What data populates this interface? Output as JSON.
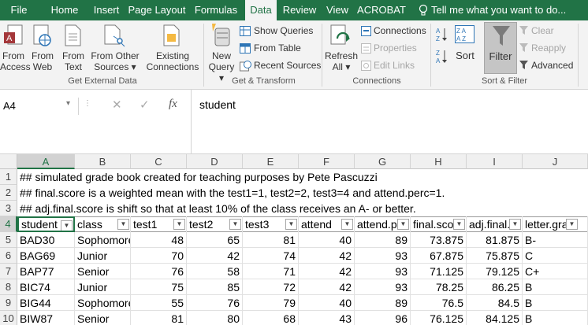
{
  "tabs": [
    "File",
    "Home",
    "Insert",
    "Page Layout",
    "Formulas",
    "Data",
    "Review",
    "View",
    "ACROBAT"
  ],
  "tell_me": "Tell me what you want to do...",
  "ribbon": {
    "from_access": [
      "From",
      "Access"
    ],
    "from_web": [
      "From",
      "Web"
    ],
    "from_text": [
      "From",
      "Text"
    ],
    "from_other": [
      "From Other",
      "Sources"
    ],
    "existing": [
      "Existing",
      "Connections"
    ],
    "group_external": "Get External Data",
    "new_query": [
      "New",
      "Query"
    ],
    "show_queries": "Show Queries",
    "from_table": "From Table",
    "recent_sources": "Recent Sources",
    "group_transform": "Get & Transform",
    "refresh_all": [
      "Refresh",
      "All"
    ],
    "connections": "Connections",
    "properties": "Properties",
    "edit_links": "Edit Links",
    "group_connections": "Connections",
    "sort": "Sort",
    "filter": "Filter",
    "clear": "Clear",
    "reapply": "Reapply",
    "advanced": "Advanced",
    "group_sort": "Sort & Filter"
  },
  "formula_bar": {
    "name_box": "A4",
    "fx": "fx",
    "content": "student"
  },
  "columns": [
    "A",
    "B",
    "C",
    "D",
    "E",
    "F",
    "G",
    "H",
    "I",
    "J"
  ],
  "rows": [
    {
      "n": "1",
      "text": "## simulated grade book created for teaching purposes by Pete Pascuzzi"
    },
    {
      "n": "2",
      "text": "## final.score is a weighted mean with the test1=1, test2=2, test3=4 and attend.perc=1."
    },
    {
      "n": "3",
      "text": "## adj.final.score is shift so that at least 10% of the class receives an A- or better."
    }
  ],
  "headers": {
    "n": "4",
    "cells": [
      "student",
      "class",
      "test1",
      "test2",
      "test3",
      "attend",
      "attend.p",
      "final.sco",
      "adj.final.",
      "letter.gra"
    ]
  },
  "data_rows": [
    {
      "n": "5",
      "cells": [
        "BAD30",
        "Sophomore",
        "48",
        "65",
        "81",
        "40",
        "89",
        "73.875",
        "81.875",
        "B-"
      ]
    },
    {
      "n": "6",
      "cells": [
        "BAG69",
        "Junior",
        "70",
        "42",
        "74",
        "42",
        "93",
        "67.875",
        "75.875",
        "C"
      ]
    },
    {
      "n": "7",
      "cells": [
        "BAP77",
        "Senior",
        "76",
        "58",
        "71",
        "42",
        "93",
        "71.125",
        "79.125",
        "C+"
      ]
    },
    {
      "n": "8",
      "cells": [
        "BIC74",
        "Junior",
        "75",
        "85",
        "72",
        "42",
        "93",
        "78.25",
        "86.25",
        "B"
      ]
    },
    {
      "n": "9",
      "cells": [
        "BIG44",
        "Sophomore",
        "55",
        "76",
        "79",
        "40",
        "89",
        "76.5",
        "84.5",
        "B"
      ]
    },
    {
      "n": "10",
      "cells": [
        "BIW87",
        "Senior",
        "81",
        "80",
        "68",
        "43",
        "96",
        "76.125",
        "84.125",
        "B"
      ]
    }
  ]
}
